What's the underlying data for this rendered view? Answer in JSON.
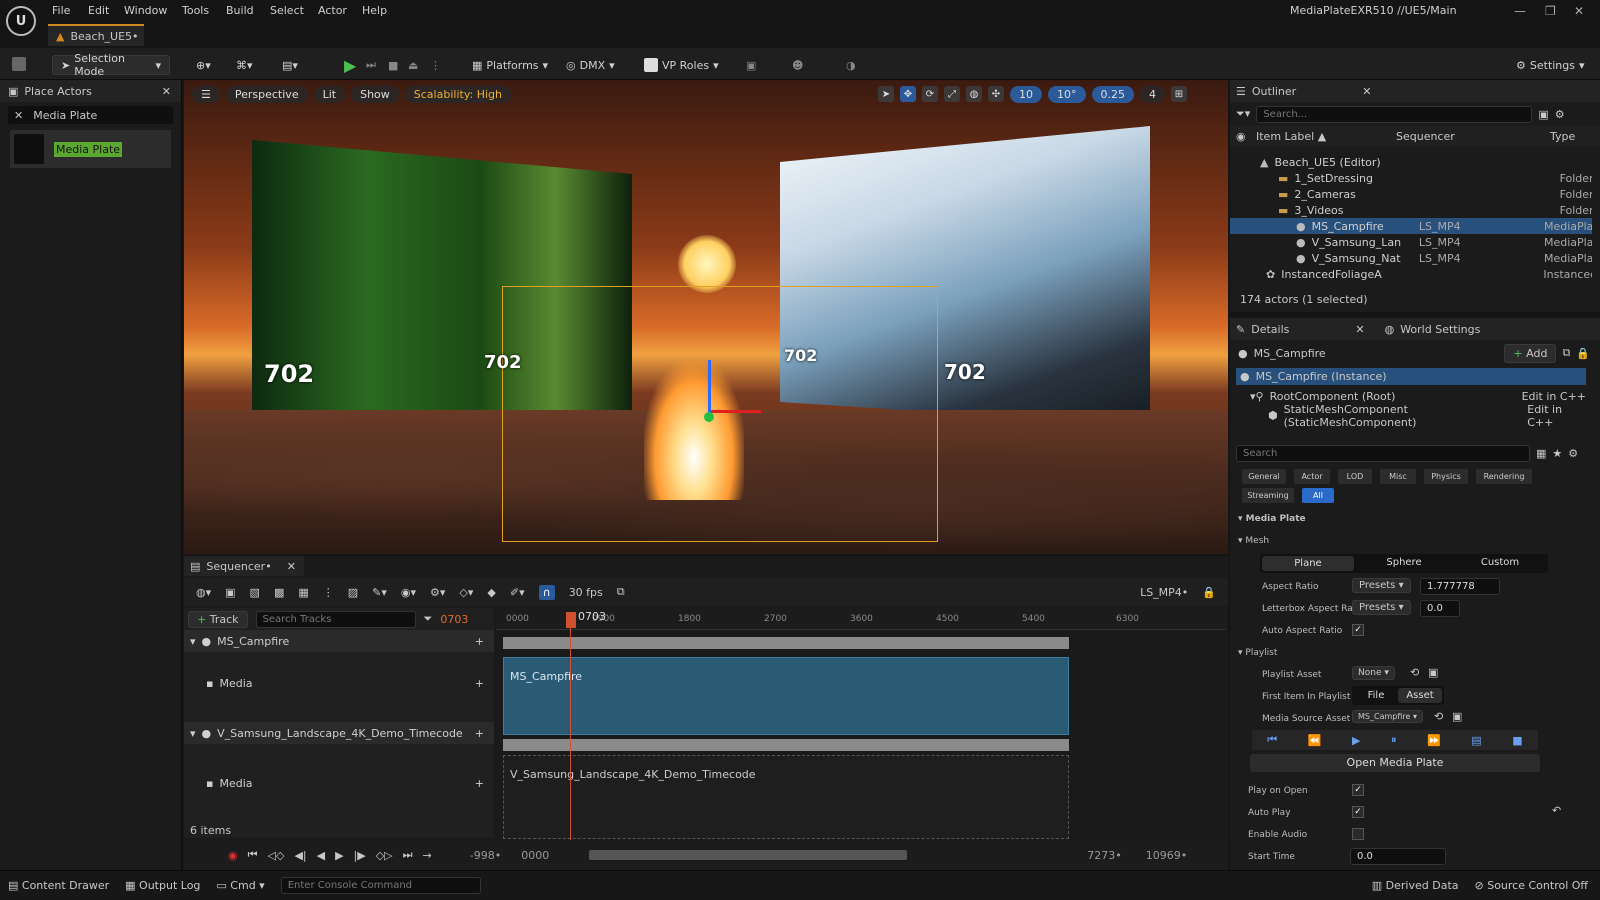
{
  "menubar": {
    "items": [
      "File",
      "Edit",
      "Window",
      "Tools",
      "Build",
      "Select",
      "Actor",
      "Help"
    ],
    "project": "MediaPlateEXR510 //UE5/Main"
  },
  "tab": {
    "label": "Beach_UE5•"
  },
  "toolbar": {
    "mode": "Selection Mode",
    "platforms": "Platforms",
    "dmx": "DMX",
    "vproles": "VP Roles",
    "settings": "Settings"
  },
  "left": {
    "title": "Place Actors",
    "search_value": "Media Plate",
    "item": "Media Plate"
  },
  "viewport": {
    "perspective": "Perspective",
    "lit": "Lit",
    "show": "Show",
    "scalability": "Scalability: High",
    "grid": "10",
    "angle": "10°",
    "scale": "0.25",
    "cam": "4",
    "tc1": "702",
    "tc2": "702",
    "tc3": "702",
    "tc4": "702"
  },
  "sequencer": {
    "title": "Sequencer•",
    "fps": "30 fps",
    "seqname": "LS_MP4•",
    "track_btn": "Track",
    "search_placeholder": "Search Tracks",
    "frame": "0703",
    "track1": "MS_Campfire",
    "track1_sub": "Media",
    "track2": "V_Samsung_Landscape_4K_Demo_Timecode",
    "track2_sub": "Media",
    "clip1": "MS_Campfire",
    "clip2": "V_Samsung_Landscape_4K_Demo_Timecode",
    "items": "6 items",
    "playhead": "0703",
    "ticks": [
      "0000",
      "0900",
      "1800",
      "2700",
      "3600",
      "4500",
      "5400",
      "6300"
    ],
    "range_start": "-998•",
    "range_in": "0000",
    "range_out": "7273•",
    "range_end": "10969•"
  },
  "outliner": {
    "title": "Outliner",
    "search_placeholder": "Search...",
    "col_label": "Item Label ▲",
    "col_seq": "Sequencer",
    "col_type": "Type",
    "rows": [
      {
        "label": "Beach_UE5 (Editor)",
        "seq": "",
        "type": ""
      },
      {
        "label": "1_SetDressing",
        "seq": "",
        "type": "Folder"
      },
      {
        "label": "2_Cameras",
        "seq": "",
        "type": "Folder"
      },
      {
        "label": "3_Videos",
        "seq": "",
        "type": "Folder"
      },
      {
        "label": "MS_Campfire",
        "seq": "LS_MP4",
        "type": "MediaPlat"
      },
      {
        "label": "V_Samsung_Lan",
        "seq": "LS_MP4",
        "type": "MediaPlat"
      },
      {
        "label": "V_Samsung_Nat",
        "seq": "LS_MP4",
        "type": "MediaPlat"
      },
      {
        "label": "InstancedFoliageA",
        "seq": "",
        "type": "Instanced"
      }
    ],
    "count": "174 actors (1 selected)"
  },
  "details": {
    "title": "Details",
    "world": "World Settings",
    "actor": "MS_Campfire",
    "add": "Add",
    "instance": "MS_Campfire (Instance)",
    "root": "RootComponent (Root)",
    "mesh_comp": "StaticMeshComponent (StaticMeshComponent)",
    "editcpp": "Edit in C++",
    "search_placeholder": "Search",
    "cats": [
      "General",
      "Actor",
      "LOD",
      "Misc",
      "Physics",
      "Rendering",
      "Streaming",
      "All"
    ],
    "sec_media": "Media Plate",
    "sec_mesh": "Mesh",
    "plane": "Plane",
    "sphere": "Sphere",
    "custom": "Custom",
    "aspect_label": "Aspect Ratio",
    "presets": "Presets",
    "aspect_value": "1.777778",
    "letterbox_label": "Letterbox Aspect Rati",
    "letterbox_value": "0.0",
    "auto_aspect": "Auto Aspect Ratio",
    "sec_playlist": "Playlist",
    "playlist_asset": "Playlist Asset",
    "none": "None",
    "first_item": "First Item In Playlist",
    "file": "File",
    "asset": "Asset",
    "media_source": "Media Source Asset",
    "media_source_val": "MS_Campfire",
    "open_btn": "Open Media Plate",
    "play_on_open": "Play on Open",
    "auto_play": "Auto Play",
    "enable_audio": "Enable Audio",
    "start_time": "Start Time",
    "start_val": "0.0"
  },
  "status": {
    "content": "Content Drawer",
    "output": "Output Log",
    "cmd": "Cmd",
    "console_placeholder": "Enter Console Command",
    "derived": "Derived Data",
    "source": "Source Control Off"
  }
}
